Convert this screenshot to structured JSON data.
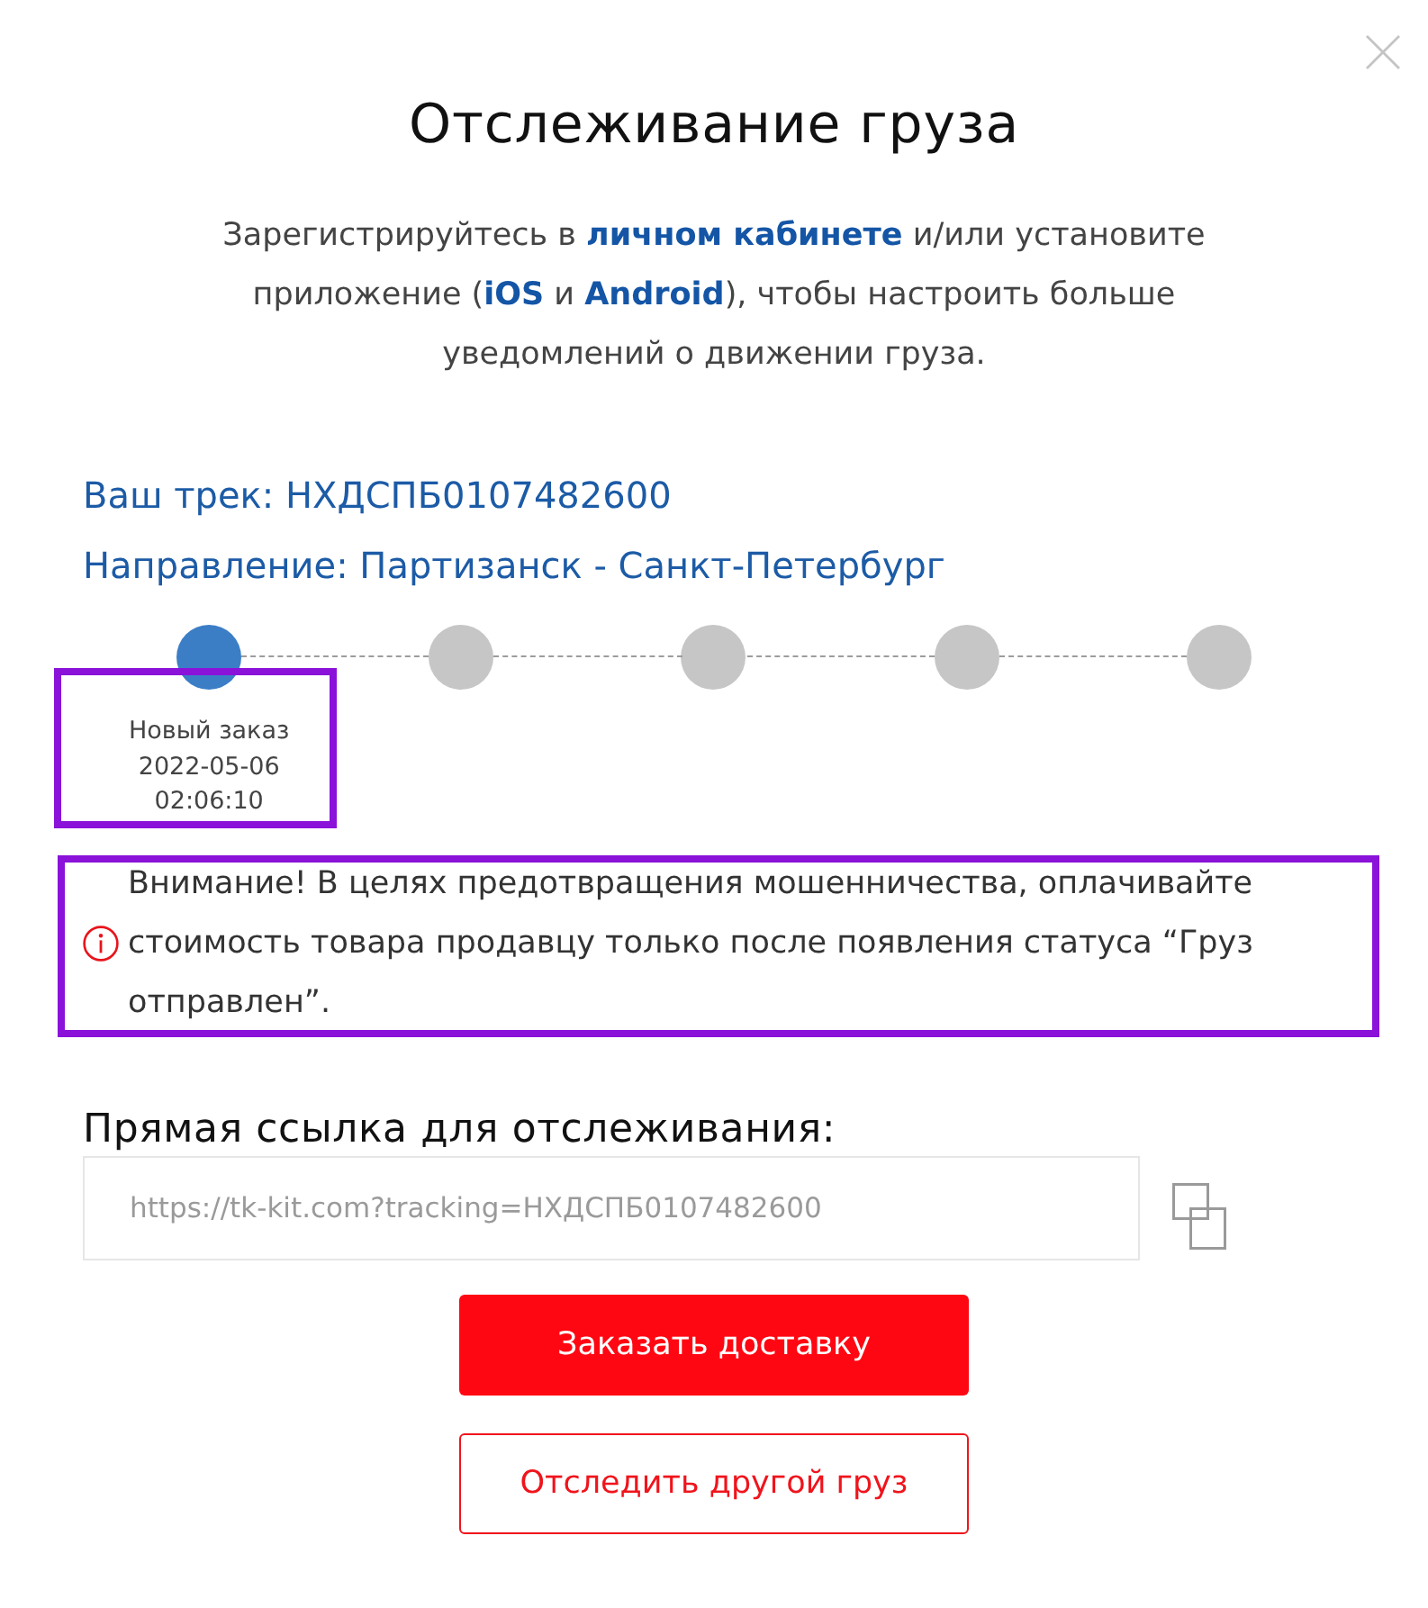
{
  "title": "Отслеживание груза",
  "intro": [
    {
      "kind": "text",
      "text": "Зарегистрируйтесь в "
    },
    {
      "kind": "link",
      "text": "личном кабинете"
    },
    {
      "kind": "text",
      "text": " и/или установите приложение ("
    },
    {
      "kind": "link",
      "text": "iOS"
    },
    {
      "kind": "text",
      "text": " и "
    },
    {
      "kind": "link",
      "text": "Android"
    },
    {
      "kind": "text",
      "text": "), чтобы настроить больше уведомлений о движении груза."
    }
  ],
  "track": "Ваш трек: НХДСПБ0107482600",
  "direction": "Направление: Партизанск - Санкт-Петербург",
  "timeline": {
    "steps": [
      {
        "reached": true,
        "highlighted": true,
        "label": "Новый заказ",
        "date": "2022-05-06",
        "time": "02:06:10"
      },
      {
        "reached": false,
        "highlighted": false
      },
      {
        "reached": false,
        "highlighted": false
      },
      {
        "reached": false,
        "highlighted": false
      },
      {
        "reached": false,
        "highlighted": false
      }
    ]
  },
  "notice": {
    "text": "Внимание! В целях предотвращения мошенничества, оплачивайте стоимость товара продавцу только после появления статуса “Груз отправлен”.",
    "highlighted": true
  },
  "link_field": {
    "label": "Прямая ссылка для отслеживания:",
    "value": "https://tk-kit.com?tracking=НХДСПБ0107482600"
  },
  "buttons": [
    {
      "kind": "primary",
      "label": "Заказать доставку"
    },
    {
      "kind": "outline",
      "label": "Отследить другой груз"
    }
  ]
}
